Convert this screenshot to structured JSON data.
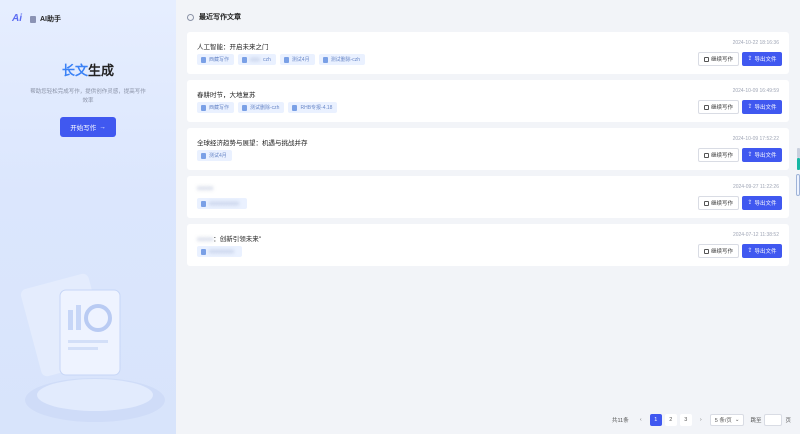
{
  "sidebar": {
    "logo_mark": "Ai",
    "logo_text": "AI助手",
    "title_a": "长文",
    "title_b": "生成",
    "description": "帮助您轻松完成写作，提供创作灵感，提高写作效率",
    "start_button": "开始写作",
    "start_icon": "arrow-right-icon"
  },
  "main": {
    "section_title": "最近写作文章",
    "continue_label": "继续写作",
    "export_label": "导出文件",
    "articles": [
      {
        "title": "人工智能：开启未来之门",
        "time": "2024-10-22 18:16:36",
        "tags": [
          "西藏写作",
          "czh",
          "测试4月",
          "测试删除-czh"
        ]
      },
      {
        "title": "春耕时节，大地复苏",
        "time": "2024-10-09 16:49:59",
        "tags": [
          "西藏写作",
          "测试删除-czh",
          "RHB专报-4.18"
        ]
      },
      {
        "title": "全球经济趋势与展望：机遇与挑战并存",
        "time": "2024-10-09 17:52:22",
        "tags": [
          "测试4月"
        ]
      },
      {
        "title": "",
        "time": "2024-09-27 11:22:26",
        "tags": [
          ""
        ]
      },
      {
        "title": "：创新引领未来\"",
        "time": "2024-07-12 11:38:52",
        "tags": [
          ""
        ]
      }
    ]
  },
  "pagination": {
    "total": "共11条",
    "pages": [
      "1",
      "2",
      "3"
    ],
    "current": "1",
    "page_size": "5 条/页",
    "jump_label": "跳至",
    "page_unit": "页"
  }
}
